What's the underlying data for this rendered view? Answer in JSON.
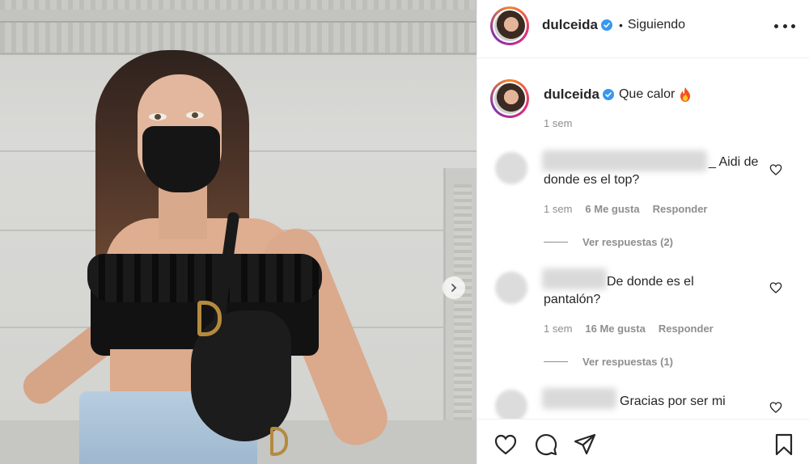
{
  "post": {
    "author": {
      "username": "dulceida",
      "verified": true,
      "follow_state": "Siguiendo"
    },
    "caption": {
      "text": "Que calor",
      "emoji_icon": "fire-emoji",
      "time": "1 sem"
    },
    "comments": [
      {
        "text": "_ Aidi de donde es el top?",
        "time": "1 sem",
        "likes": "6 Me gusta",
        "reply_label": "Responder",
        "view_replies": "Ver respuestas (2)"
      },
      {
        "text": "De donde es el pantalón?",
        "time": "1 sem",
        "likes": "16 Me gusta",
        "reply_label": "Responder",
        "view_replies": "Ver respuestas (1)"
      },
      {
        "text": "Gracias por ser mi"
      }
    ]
  },
  "icons": {
    "more": "more-options-icon",
    "like": "heart-icon",
    "comment": "comment-icon",
    "share": "paper-plane-icon",
    "save": "bookmark-icon",
    "carousel_next": "chevron-right-icon",
    "verified": "verified-badge-icon"
  },
  "colors": {
    "text": "#262626",
    "secondary": "#8e8e8e",
    "verified": "#3897f0",
    "border": "#efefef"
  }
}
